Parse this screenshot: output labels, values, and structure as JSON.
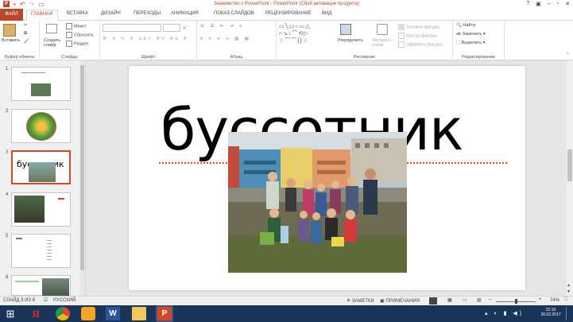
{
  "window": {
    "title": "Знакомство с PowerPoint - PowerPoint (Сбой активации продукта)",
    "accent": "#b7472a"
  },
  "qat": {
    "save_icon": "save-icon",
    "undo_icon": "undo-icon",
    "redo_icon": "redo-icon",
    "present_icon": "start-slideshow-icon"
  },
  "tabs": [
    {
      "label": "ФАЙЛ"
    },
    {
      "label": "ГЛАВНАЯ"
    },
    {
      "label": "ВСТАВКА"
    },
    {
      "label": "ДИЗАЙН"
    },
    {
      "label": "ПЕРЕХОДЫ"
    },
    {
      "label": "АНИМАЦИЯ"
    },
    {
      "label": "ПОКАЗ СЛАЙДОВ"
    },
    {
      "label": "РЕЦЕНЗИРОВАНИЕ"
    },
    {
      "label": "ВИД"
    }
  ],
  "ribbon": {
    "clipboard": {
      "paste": "Вставить",
      "group": "Буфер обмена"
    },
    "slides": {
      "new_slide": "Создать слайд",
      "layout": "Макет",
      "reset": "Сбросить",
      "section": "Раздел",
      "group": "Слайды"
    },
    "font": {
      "group": "Шрифт",
      "font_name": "",
      "font_size": ""
    },
    "paragraph": {
      "group": "Абзац"
    },
    "drawing": {
      "arrange": "Упорядочить",
      "quick_styles": "Экспресс-стили",
      "fill": "Заливка фигуры",
      "outline": "Контур фигуры",
      "effects": "Эффекты фигуры",
      "group": "Рисование"
    },
    "editing": {
      "find": "Найти",
      "replace": "Заменить",
      "select": "Выделить",
      "group": "Редактирование"
    }
  },
  "thumbnails": [
    {
      "num": "1"
    },
    {
      "num": "2"
    },
    {
      "num": "3",
      "text": "буссотник"
    },
    {
      "num": "4"
    },
    {
      "num": "5"
    },
    {
      "num": "6"
    }
  ],
  "slide": {
    "title": "буссотник"
  },
  "status": {
    "slide_info": "СЛАЙД 3 ИЗ 6",
    "language": "РУССКИЙ",
    "notes": "ЗАМЕТКИ",
    "comments": "ПРИМЕЧАНИЯ",
    "zoom": "74%"
  },
  "taskbar": {
    "time": "22:10",
    "date": "26.02.2017"
  }
}
